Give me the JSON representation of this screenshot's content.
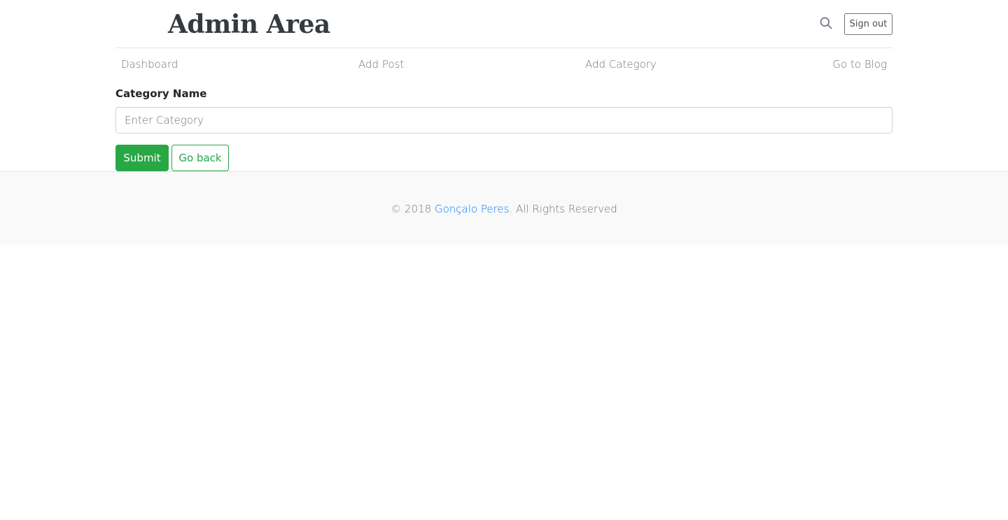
{
  "header": {
    "title": "Admin Area",
    "search_icon": "search-icon",
    "signout_label": "Sign out"
  },
  "nav": {
    "items": [
      {
        "label": "Dashboard"
      },
      {
        "label": "Add Post"
      },
      {
        "label": "Add Category"
      },
      {
        "label": "Go to Blog"
      }
    ]
  },
  "form": {
    "label": "Category Name",
    "input_value": "",
    "input_placeholder": "Enter Category",
    "submit_label": "Submit",
    "goback_label": "Go back"
  },
  "footer": {
    "prefix": "© 2018 ",
    "author": "Gonçalo Peres",
    "suffix": ". All Rights Reserved"
  },
  "colors": {
    "accent_green": "#28a745",
    "link_blue": "#007bff"
  }
}
